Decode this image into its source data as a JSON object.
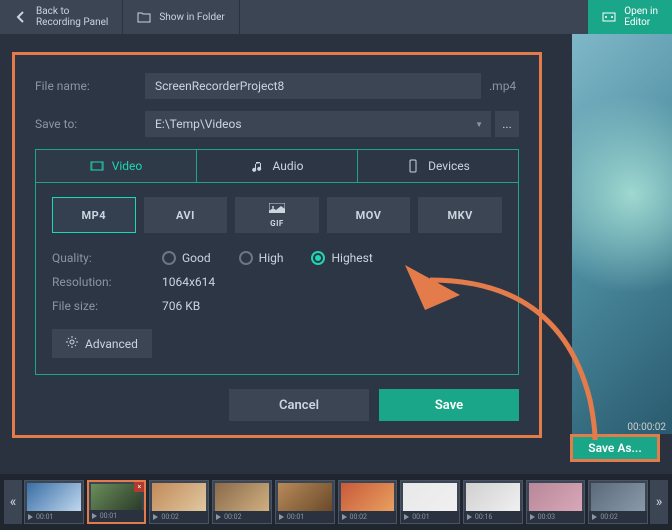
{
  "topbar": {
    "back": "Back to\nRecording Panel",
    "show_folder": "Show in Folder",
    "open_editor": "Open in\nEditor"
  },
  "dialog": {
    "filename_label": "File name:",
    "filename": "ScreenRecorderProject8",
    "ext": ".mp4",
    "saveto_label": "Save to:",
    "saveto": "E:\\Temp\\Videos",
    "tabs": {
      "video": "Video",
      "audio": "Audio",
      "devices": "Devices"
    },
    "formats": [
      "MP4",
      "AVI",
      "GIF",
      "MOV",
      "MKV"
    ],
    "quality_label": "Quality:",
    "quality": {
      "good": "Good",
      "high": "High",
      "highest": "Highest"
    },
    "resolution_label": "Resolution:",
    "resolution": "1064x614",
    "filesize_label": "File size:",
    "filesize": "706 KB",
    "advanced": "Advanced",
    "cancel": "Cancel",
    "save": "Save"
  },
  "save_as": "Save As...",
  "time_current": "00:00:02",
  "thumbs": [
    {
      "time": "00:01",
      "colors": [
        "#3a6ea5",
        "#c0d8ef"
      ]
    },
    {
      "time": "00:01",
      "colors": [
        "#6b8e5a",
        "#2a3a28"
      ],
      "selected": true,
      "closable": true
    },
    {
      "time": "00:02",
      "colors": [
        "#c28a5a",
        "#e0c8a0"
      ]
    },
    {
      "time": "00:02",
      "colors": [
        "#8a6a4a",
        "#d0b080"
      ]
    },
    {
      "time": "00:01",
      "colors": [
        "#b88a5a",
        "#6a4a2a"
      ]
    },
    {
      "time": "00:02",
      "colors": [
        "#c85a3a",
        "#e8a060"
      ]
    },
    {
      "time": "00:01",
      "colors": [
        "#e8e8e8",
        "#f0f0f0"
      ]
    },
    {
      "time": "00:16",
      "colors": [
        "#d0d0d0",
        "#f0f0f0"
      ]
    },
    {
      "time": "00:03",
      "colors": [
        "#b8889a",
        "#d8a8b8"
      ]
    },
    {
      "time": "00:02",
      "colors": [
        "#5a6a7a",
        "#8a9aaa"
      ]
    }
  ]
}
